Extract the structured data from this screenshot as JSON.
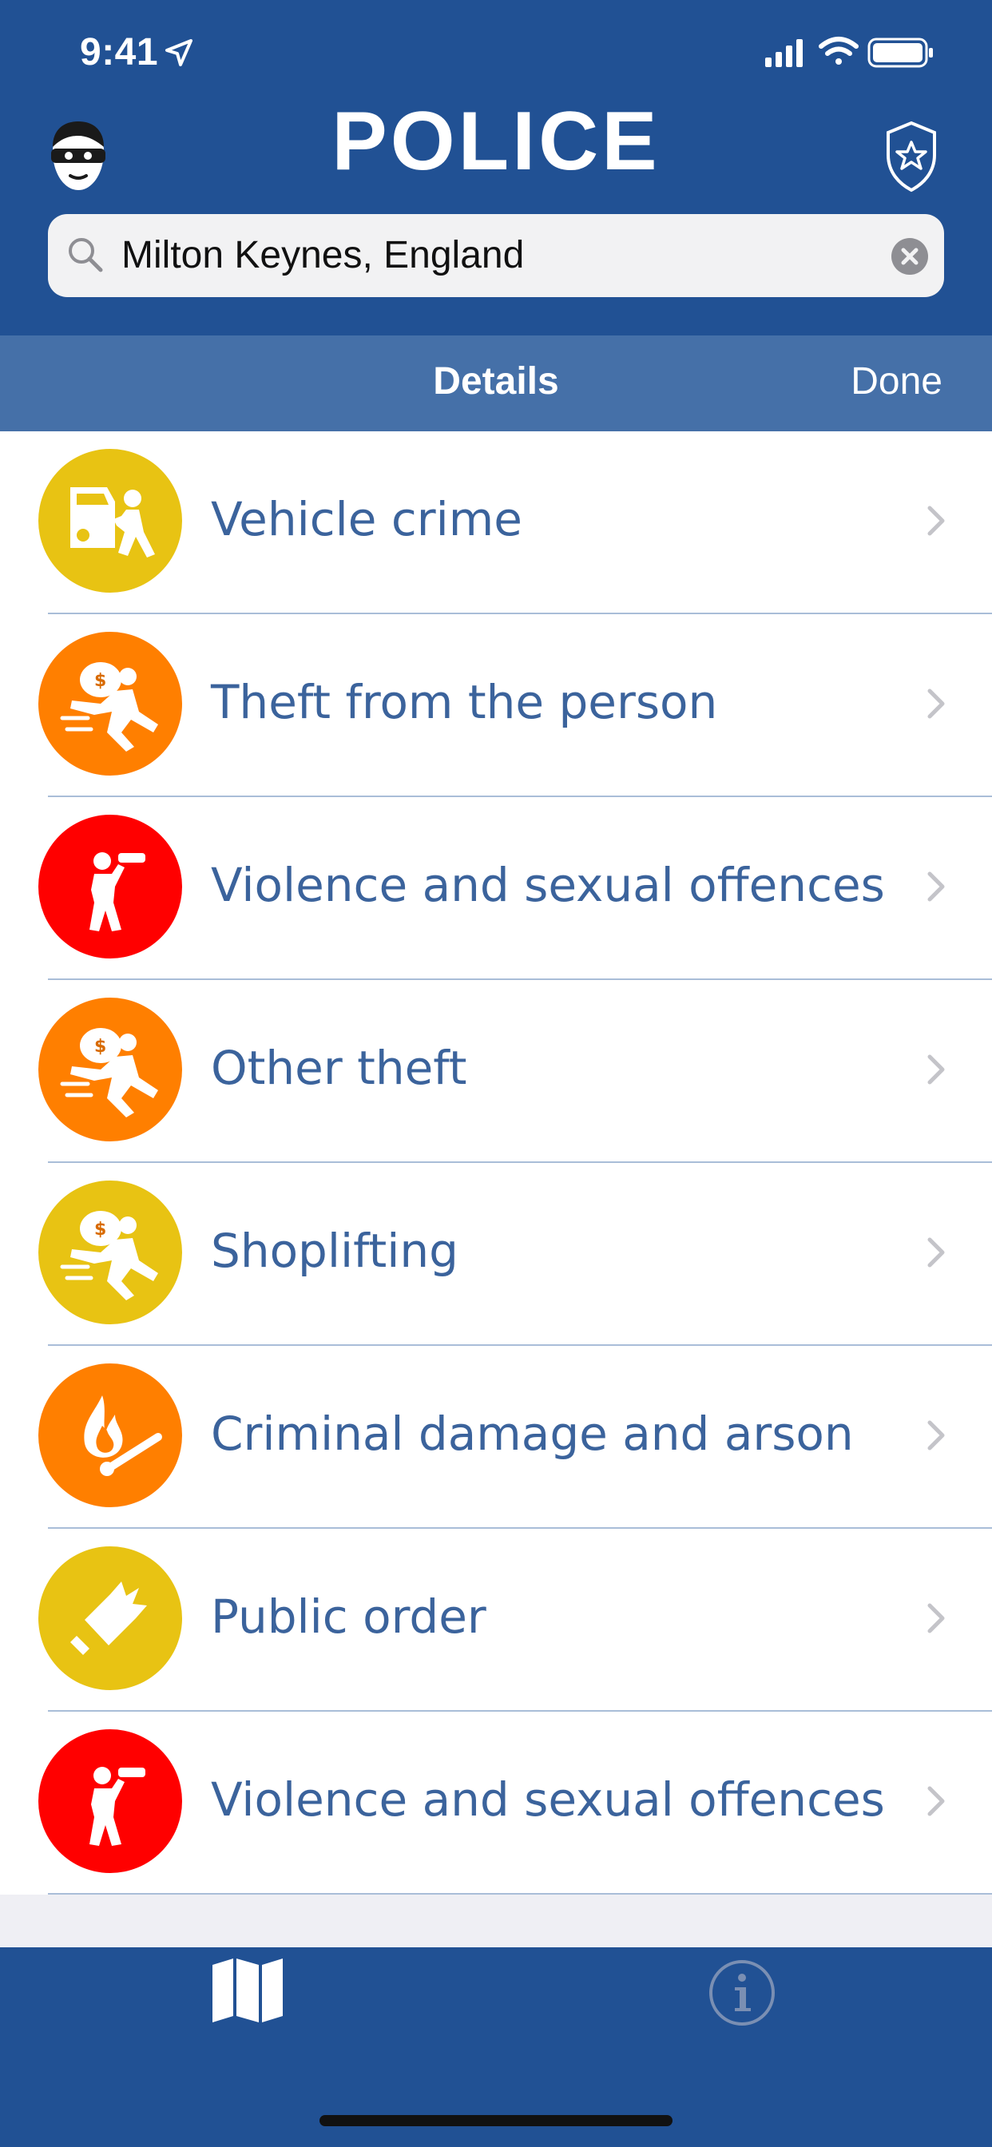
{
  "status_bar": {
    "time": "9:41"
  },
  "header": {
    "title": "POLICE",
    "left_icon": "robber-mask-icon",
    "right_icon": "police-badge-icon"
  },
  "search": {
    "value": "Milton Keynes, England"
  },
  "navbar": {
    "title": "Details",
    "done_label": "Done"
  },
  "crimes": [
    {
      "label": "Vehicle crime",
      "color": "#e8c313",
      "icon": "vehicle-crime-icon"
    },
    {
      "label": "Theft from the person",
      "color": "#ff7f00",
      "icon": "thief-running-icon"
    },
    {
      "label": "Violence and sexual offences",
      "color": "#ff0000",
      "icon": "violence-icon"
    },
    {
      "label": "Other theft",
      "color": "#ff7f00",
      "icon": "thief-running-icon"
    },
    {
      "label": "Shoplifting",
      "color": "#e8c313",
      "icon": "thief-running-icon"
    },
    {
      "label": "Criminal damage and arson",
      "color": "#ff7f00",
      "icon": "match-fire-icon"
    },
    {
      "label": "Public order",
      "color": "#e8c313",
      "icon": "broken-bottle-icon"
    },
    {
      "label": "Violence and sexual offences",
      "color": "#ff0000",
      "icon": "violence-icon"
    }
  ],
  "tabbar": {
    "tabs": [
      "map-icon",
      "info-icon"
    ]
  },
  "colors": {
    "brand": "#215194",
    "navbar": "#4570a8",
    "label": "#3b639c"
  }
}
